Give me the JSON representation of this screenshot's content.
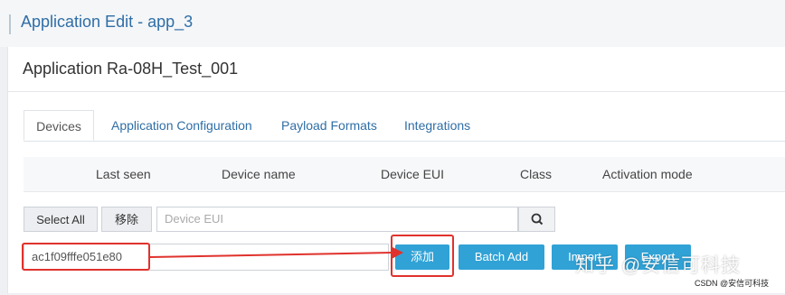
{
  "header": {
    "title": "Application Edit - app_3"
  },
  "panel": {
    "title": "Application Ra-08H_Test_001"
  },
  "tabs": [
    {
      "label": "Devices"
    },
    {
      "label": "Application Configuration"
    },
    {
      "label": "Payload Formats"
    },
    {
      "label": "Integrations"
    }
  ],
  "table": {
    "columns": [
      "Last seen",
      "Device name",
      "Device EUI",
      "Class",
      "Activation mode"
    ]
  },
  "toolbar": {
    "select_all_label": "Select All",
    "remove_label": "移除",
    "eui_search_placeholder": "Device EUI"
  },
  "add_row": {
    "eui_value": "ac1f09fffe051e80",
    "add_label": "添加",
    "batch_add_label": "Batch Add",
    "import_label": "Import",
    "export_label": "Export"
  },
  "watermark": {
    "main": "知乎 @安信可科技",
    "footer": "CSDN @安信可科技"
  },
  "colors": {
    "accent_blue": "#30a2d6",
    "highlight_red": "#e0322d",
    "link_blue": "#2f6ea6"
  },
  "icons": [
    "search-icon",
    "arrow-icon"
  ]
}
